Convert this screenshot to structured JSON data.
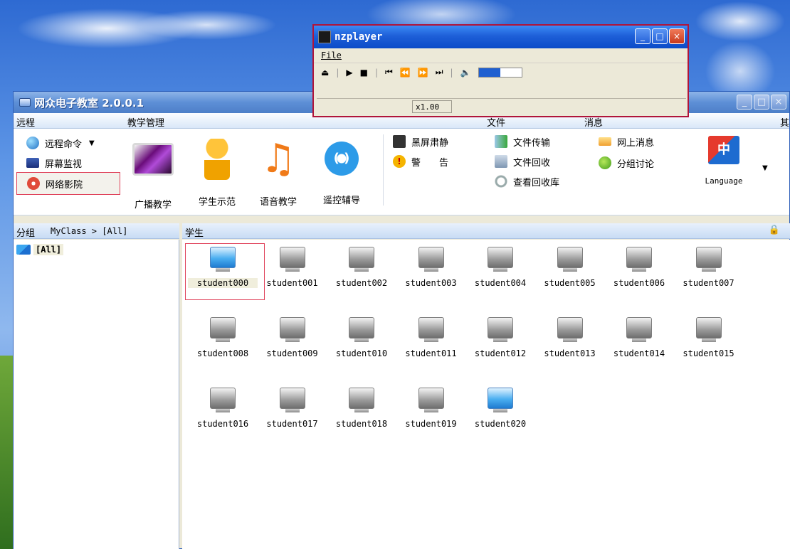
{
  "app": {
    "title": "网众电子教室 2.0.0.1"
  },
  "menu": {
    "remote": "远程",
    "teaching": "教学管理",
    "file": "文件",
    "message": "消息",
    "other": "其"
  },
  "toolbar": {
    "remote_cmd": "远程命令",
    "screen_monitor": "屏幕监视",
    "net_cinema": "网络影院",
    "broadcast": "广播教学",
    "student_demo": "学生示范",
    "voice": "语音教学",
    "remote_assist": "遥控辅导",
    "black_screen": "黑屏肃静",
    "warning": "警　　告",
    "file_transfer": "文件传输",
    "file_recycle": "文件回收",
    "view_recycle": "查看回收库",
    "online_msg": "网上消息",
    "group_discuss": "分组讨论",
    "language": "Language"
  },
  "left": {
    "group_label": "分组",
    "path": "MyClass > [All]",
    "tree_item": "[All]"
  },
  "right": {
    "header": "学生"
  },
  "students": [
    {
      "name": "student000",
      "online": true,
      "selected": true
    },
    {
      "name": "student001",
      "online": false
    },
    {
      "name": "student002",
      "online": false
    },
    {
      "name": "student003",
      "online": false
    },
    {
      "name": "student004",
      "online": false
    },
    {
      "name": "student005",
      "online": false
    },
    {
      "name": "student006",
      "online": false
    },
    {
      "name": "student007",
      "online": false
    },
    {
      "name": "student008",
      "online": false
    },
    {
      "name": "student009",
      "online": false
    },
    {
      "name": "student010",
      "online": false
    },
    {
      "name": "student011",
      "online": false
    },
    {
      "name": "student012",
      "online": false
    },
    {
      "name": "student013",
      "online": false
    },
    {
      "name": "student014",
      "online": false
    },
    {
      "name": "student015",
      "online": false
    },
    {
      "name": "student016",
      "online": false
    },
    {
      "name": "student017",
      "online": false
    },
    {
      "name": "student018",
      "online": false
    },
    {
      "name": "student019",
      "online": false
    },
    {
      "name": "student020",
      "online": true
    }
  ],
  "player": {
    "title": "nzplayer",
    "menu_file": "File",
    "speed": "x1.00"
  }
}
